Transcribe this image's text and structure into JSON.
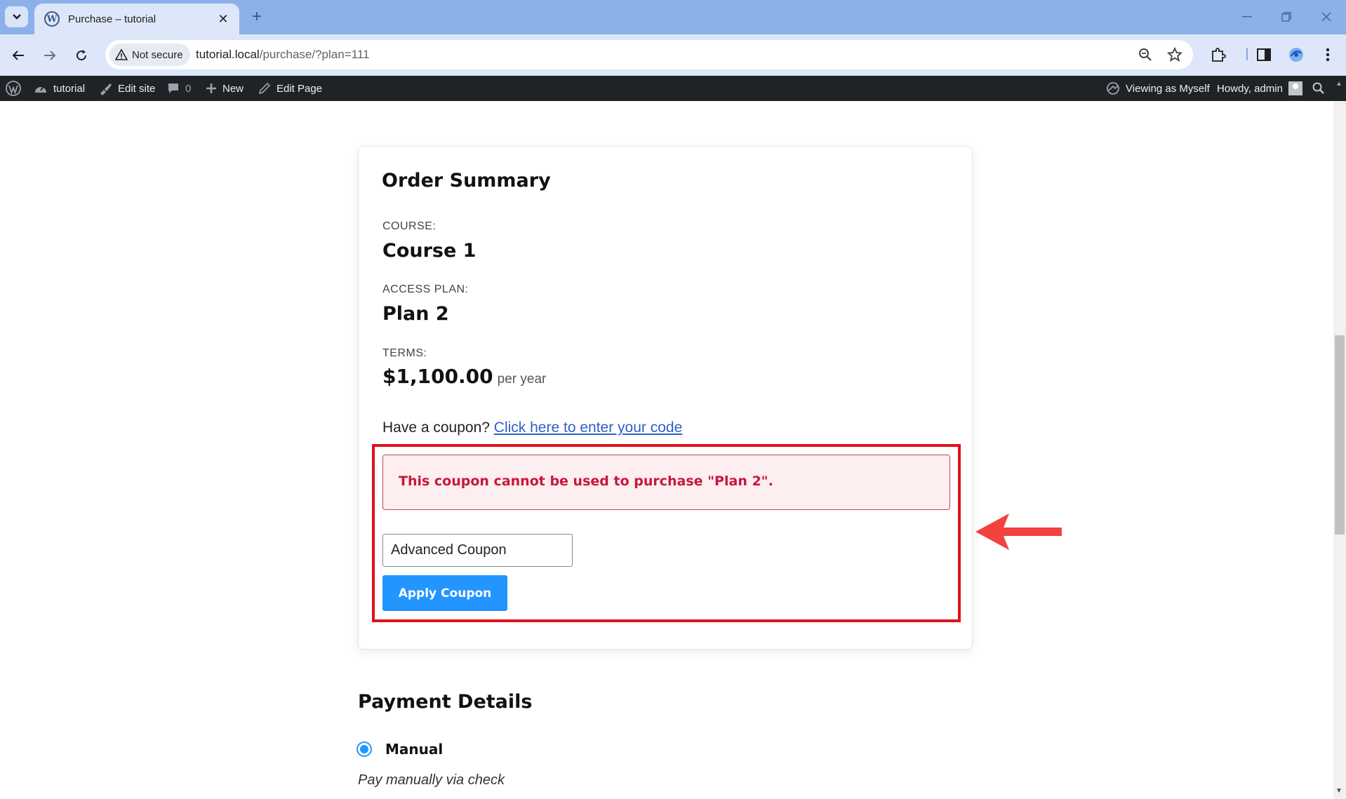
{
  "browser": {
    "tab_title": "Purchase – tutorial",
    "tab_close": "✕",
    "new_tab": "+",
    "security_label": "Not secure",
    "url_host": "tutorial.local",
    "url_path": "/purchase/?plan=111"
  },
  "adminbar": {
    "site_name": "tutorial",
    "edit_site": "Edit site",
    "comments_count": "0",
    "new_label": "New",
    "edit_page": "Edit Page",
    "viewing_as": "Viewing as Myself",
    "howdy": "Howdy, admin"
  },
  "order_summary": {
    "title": "Order Summary",
    "course_label": "COURSE:",
    "course_value": "Course 1",
    "plan_label": "ACCESS PLAN:",
    "plan_value": "Plan 2",
    "terms_label": "TERMS:",
    "price": "$1,100.00",
    "period": "per year"
  },
  "coupon": {
    "prompt": "Have a coupon?",
    "link_text": "Click here to enter your code",
    "error_message": "This coupon cannot be used to purchase \"Plan 2\".",
    "input_value": "Advanced Coupon",
    "apply_label": "Apply Coupon"
  },
  "payment": {
    "title": "Payment Details",
    "method_label": "Manual",
    "method_description": "Pay manually via check"
  },
  "colors": {
    "highlight_border": "#e0121d",
    "arrow": "#f1423e",
    "primary_button": "#2295ff",
    "error_text": "#c8173c"
  }
}
